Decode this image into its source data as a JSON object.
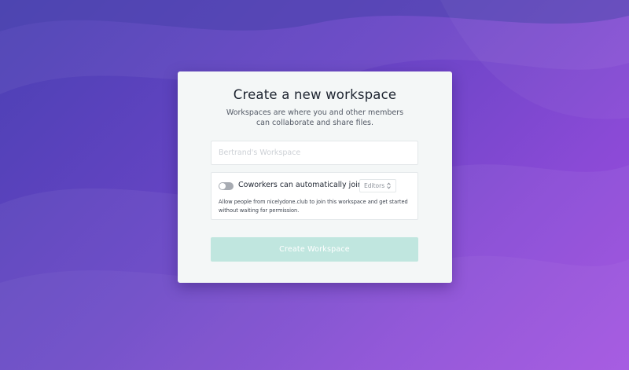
{
  "card": {
    "title": "Create a new workspace",
    "subtitle_line1": "Workspaces are where you and other members",
    "subtitle_line2": "can collaborate and share files."
  },
  "workspace_name": {
    "value": "",
    "placeholder": "Bertrand's Workspace"
  },
  "auto_join": {
    "enabled": false,
    "label": "Coworkers can automatically join as",
    "role_value": "Editors",
    "help_line1": "Allow people from nicelydone.club to join this workspace and get started",
    "help_line2": "without waiting for permission."
  },
  "actions": {
    "create_label": "Create Workspace"
  },
  "colors": {
    "background_start": "#4a40b3",
    "background_end": "#a04ee0",
    "card": "#f4f7f7",
    "button_disabled": "#c0e6df",
    "toggle_off": "#a7abb2"
  },
  "icons": {
    "role_select": "updown-chevron-icon",
    "toggle": "toggle-off-icon"
  }
}
